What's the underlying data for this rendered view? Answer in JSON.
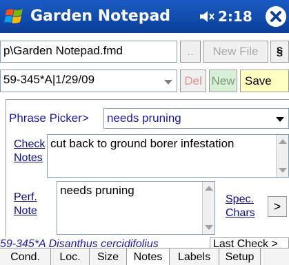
{
  "titlebar": {
    "title": "Garden Notepad",
    "clock": "2:18",
    "icons": [
      "windows-logo-icon",
      "volume-icon",
      "close-icon"
    ]
  },
  "file": {
    "path": "p\\Garden Notepad.fmd",
    "browse_label": "..",
    "new_file_label": "New File",
    "section_label": "§"
  },
  "record": {
    "selected": "59-345*A|1/29/09",
    "del_label": "Del",
    "new_label": "New",
    "save_label": "Save"
  },
  "phrase": {
    "label": "Phrase Picker>",
    "selected": "needs pruning"
  },
  "check_notes": {
    "label_line1": "Check",
    "label_line2": "Notes",
    "text": "cut back to ground borer infestation"
  },
  "perf_note": {
    "label_line1": "Perf.",
    "label_line2": "Note",
    "text": "needs pruning",
    "spec_line1": "Spec.",
    "spec_line2": "Chars",
    "arrow_label": ">"
  },
  "status": {
    "plant": "59-345*A Disanthus cercidifolius",
    "last_check": "Last Check >"
  },
  "tabs": [
    {
      "label": "Cond."
    },
    {
      "label": "Loc."
    },
    {
      "label": "Size"
    },
    {
      "label": "Notes"
    },
    {
      "label": "Labels"
    },
    {
      "label": "Setup"
    }
  ],
  "colors": {
    "titlebar": "#0b3f98",
    "label_blue": "#1a1aa8",
    "del_text": "#e89090",
    "new_bg": "#d8f0d8",
    "save_bg": "#ffffc0"
  }
}
